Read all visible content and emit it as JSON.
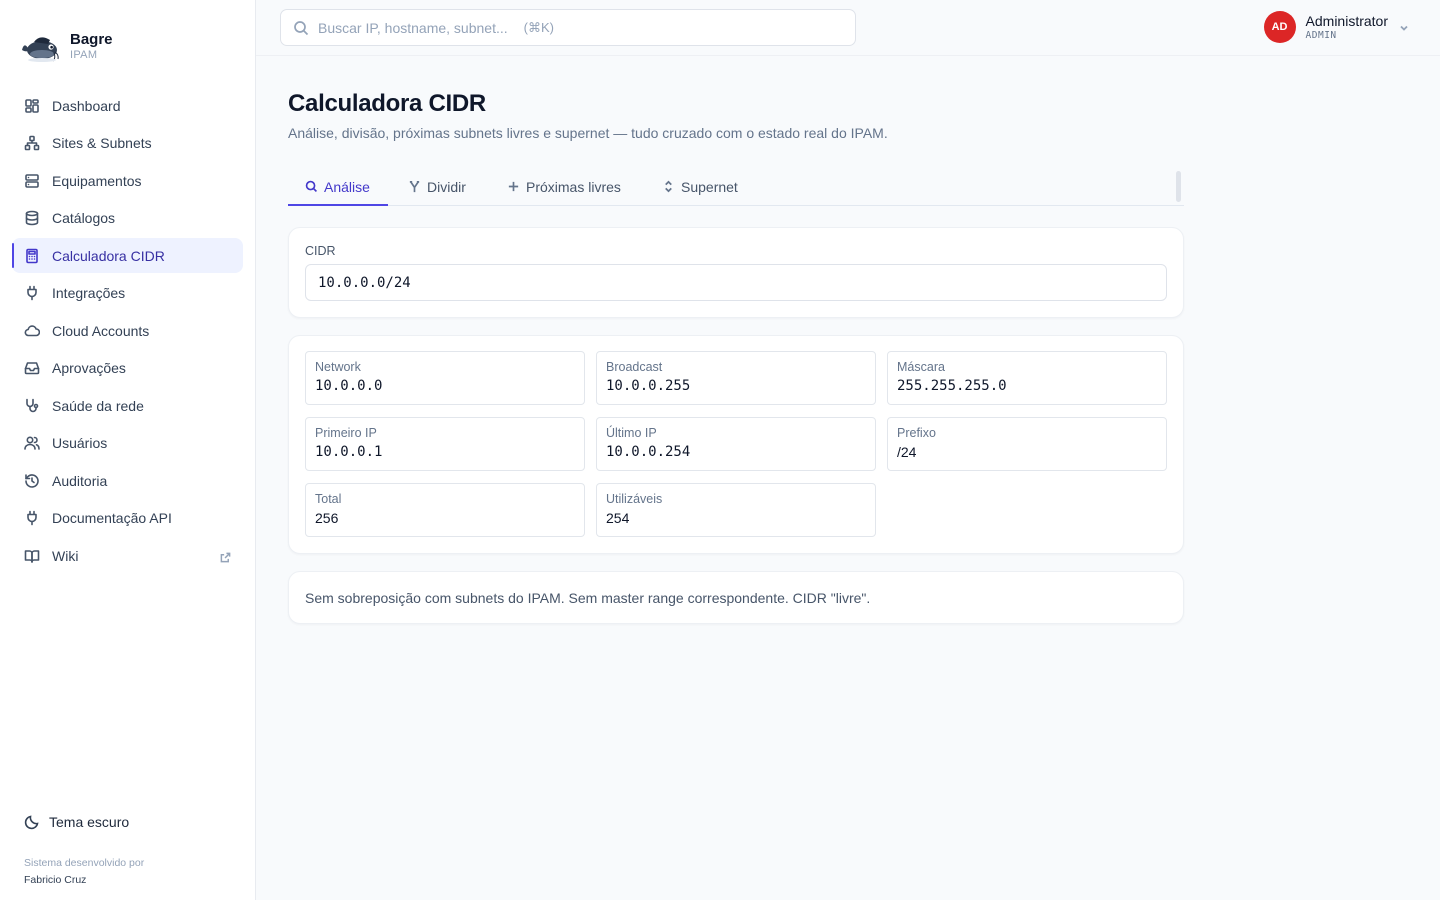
{
  "brand": {
    "name": "Bagre",
    "sub": "IPAM"
  },
  "sidebar": {
    "items": [
      {
        "label": "Dashboard",
        "icon": "dashboard-icon",
        "active": false
      },
      {
        "label": "Sites & Subnets",
        "icon": "sitemap-icon",
        "active": false
      },
      {
        "label": "Equipamentos",
        "icon": "server-icon",
        "active": false
      },
      {
        "label": "Catálogos",
        "icon": "database-icon",
        "active": false
      },
      {
        "label": "Calculadora CIDR",
        "icon": "calculator-icon",
        "active": true
      },
      {
        "label": "Integrações",
        "icon": "plug-icon",
        "active": false
      },
      {
        "label": "Cloud Accounts",
        "icon": "cloud-icon",
        "active": false
      },
      {
        "label": "Aprovações",
        "icon": "inbox-icon",
        "active": false
      },
      {
        "label": "Saúde da rede",
        "icon": "stethoscope-icon",
        "active": false
      },
      {
        "label": "Usuários",
        "icon": "users-icon",
        "active": false
      },
      {
        "label": "Auditoria",
        "icon": "history-icon",
        "active": false
      },
      {
        "label": "Documentação API",
        "icon": "plug-icon",
        "active": false
      },
      {
        "label": "Wiki",
        "icon": "book-icon",
        "active": false,
        "external": true
      }
    ],
    "theme_toggle": "Tema escuro",
    "credit_line1": "Sistema desenvolvido por",
    "credit_line2": "Fabricio Cruz"
  },
  "search": {
    "placeholder": "Buscar IP, hostname, subnet...",
    "shortcut": "(⌘K)"
  },
  "user": {
    "initials": "AD",
    "name": "Administrator",
    "role": "ADMIN",
    "avatar_color": "#dc2626"
  },
  "page": {
    "title": "Calculadora CIDR",
    "subtitle": "Análise, divisão, próximas subnets livres e supernet — tudo cruzado com o estado real do IPAM."
  },
  "tabs": [
    {
      "label": "Análise",
      "icon": "search-icon",
      "active": true
    },
    {
      "label": "Dividir",
      "icon": "split-icon",
      "active": false
    },
    {
      "label": "Próximas livres",
      "icon": "plus-icon",
      "active": false
    },
    {
      "label": "Supernet",
      "icon": "chevrons-updown-icon",
      "active": false
    }
  ],
  "cidr": {
    "label": "CIDR",
    "value": "10.0.0.0/24"
  },
  "results": [
    {
      "key": "Network",
      "value": "10.0.0.0",
      "mono": true
    },
    {
      "key": "Broadcast",
      "value": "10.0.0.255",
      "mono": true
    },
    {
      "key": "Máscara",
      "value": "255.255.255.0",
      "mono": true
    },
    {
      "key": "Primeiro IP",
      "value": "10.0.0.1",
      "mono": true
    },
    {
      "key": "Último IP",
      "value": "10.0.0.254",
      "mono": true
    },
    {
      "key": "Prefixo",
      "value": "/24",
      "mono": false
    },
    {
      "key": "Total",
      "value": "256",
      "mono": false
    },
    {
      "key": "Utilizáveis",
      "value": "254",
      "mono": false
    }
  ],
  "note": "Sem sobreposição com subnets do IPAM. Sem master range correspondente. CIDR \"livre\".",
  "colors": {
    "accent": "#4f46e5",
    "active_bg": "#eef2ff"
  }
}
